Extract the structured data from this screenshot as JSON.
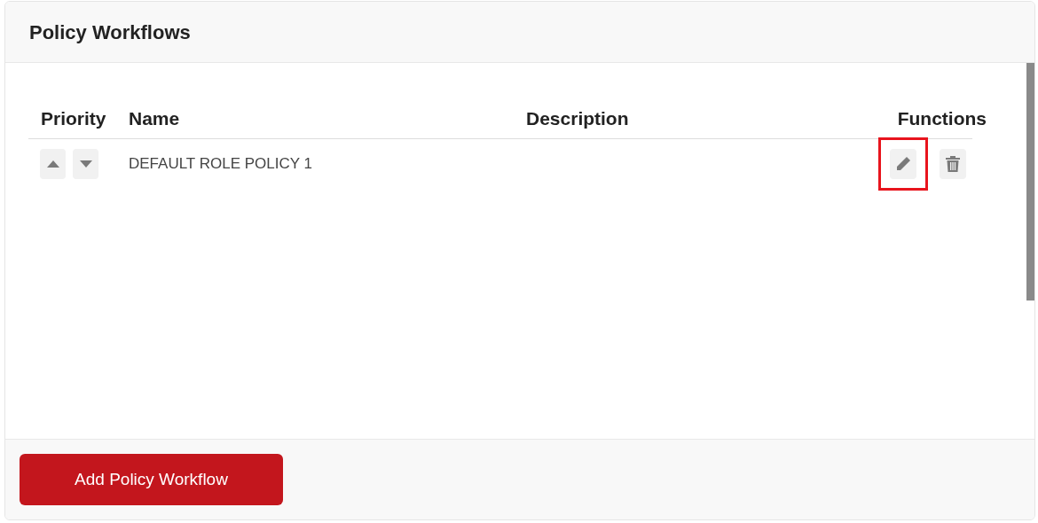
{
  "title": "Policy Workflows",
  "table": {
    "columns": [
      "Priority",
      "Name",
      "Description",
      "Functions"
    ],
    "rows": [
      {
        "name": "DEFAULT ROLE POLICY 1",
        "functions": [
          {
            "kind": "edit",
            "highlighted": true
          },
          {
            "kind": "delete",
            "highlighted": false
          }
        ]
      }
    ]
  },
  "footer": {
    "button": "Add Policy Workflow"
  }
}
